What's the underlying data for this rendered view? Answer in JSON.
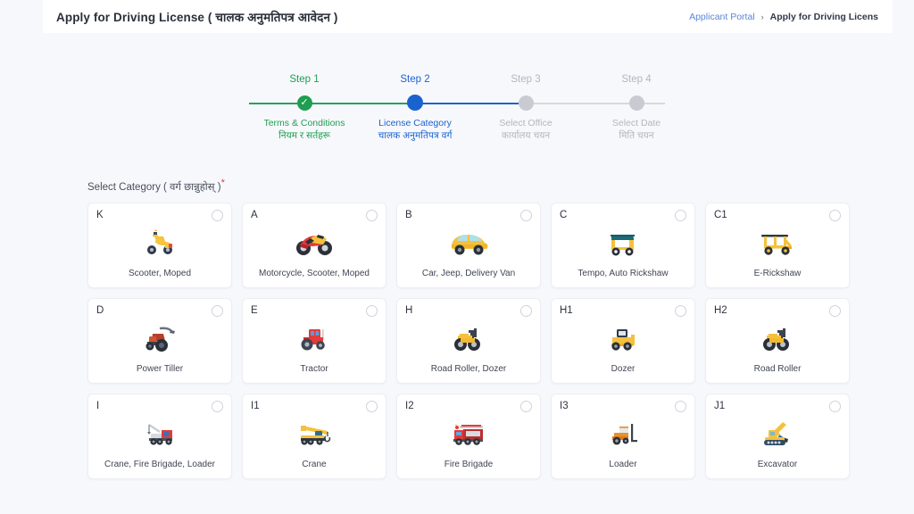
{
  "header": {
    "title": "Apply for Driving License ( चालक अनुमतिपत्र आवेदन )",
    "breadcrumb": {
      "link": "Applicant Portal",
      "separator": "›",
      "current": "Apply for Driving Licens"
    }
  },
  "stepper": {
    "steps": [
      {
        "number": "Step 1",
        "label_en": "Terms & Conditions",
        "label_np": "नियम र सर्तहरू",
        "state": "done",
        "check_glyph": "✓",
        "color": "#1f9e51"
      },
      {
        "number": "Step 2",
        "label_en": "License Category",
        "label_np": "चालक अनुमतिपत्र वर्ग",
        "state": "active",
        "check_glyph": "",
        "color": "#1a63cf"
      },
      {
        "number": "Step 3",
        "label_en": "Select Office",
        "label_np": "कार्यालय चयन",
        "state": "todo",
        "check_glyph": "",
        "color": "#b3b6bf"
      },
      {
        "number": "Step 4",
        "label_en": "Select Date",
        "label_np": "मिति चयन",
        "state": "todo",
        "check_glyph": "",
        "color": "#b3b6bf"
      }
    ]
  },
  "form": {
    "select_label": "Select Category ( वर्ग छान्नुहोस् )",
    "required_mark": "*"
  },
  "categories": [
    {
      "code": "K",
      "name": "Scooter, Moped",
      "icon": "scooter-icon",
      "selected": false
    },
    {
      "code": "A",
      "name": "Motorcycle, Scooter, Moped",
      "icon": "motorcycle-icon",
      "selected": false
    },
    {
      "code": "B",
      "name": "Car, Jeep, Delivery Van",
      "icon": "car-icon",
      "selected": false
    },
    {
      "code": "C",
      "name": "Tempo, Auto Rickshaw",
      "icon": "auto-rickshaw-icon",
      "selected": false
    },
    {
      "code": "C1",
      "name": "E-Rickshaw",
      "icon": "e-rickshaw-icon",
      "selected": false
    },
    {
      "code": "D",
      "name": "Power Tiller",
      "icon": "power-tiller-icon",
      "selected": false
    },
    {
      "code": "E",
      "name": "Tractor",
      "icon": "tractor-icon",
      "selected": false
    },
    {
      "code": "H",
      "name": "Road Roller, Dozer",
      "icon": "road-roller-icon",
      "selected": false
    },
    {
      "code": "H1",
      "name": "Dozer",
      "icon": "dozer-icon",
      "selected": false
    },
    {
      "code": "H2",
      "name": "Road Roller",
      "icon": "road-roller-icon",
      "selected": false
    },
    {
      "code": "I",
      "name": "Crane, Fire Brigade, Loader",
      "icon": "crane-truck-icon",
      "selected": false
    },
    {
      "code": "I1",
      "name": "Crane",
      "icon": "mobile-crane-icon",
      "selected": false
    },
    {
      "code": "I2",
      "name": "Fire Brigade",
      "icon": "fire-engine-icon",
      "selected": false
    },
    {
      "code": "I3",
      "name": "Loader",
      "icon": "forklift-icon",
      "selected": false
    },
    {
      "code": "J1",
      "name": "Excavator",
      "icon": "excavator-icon",
      "selected": false
    }
  ],
  "colors": {
    "page_bg": "#f7f8fc",
    "card_bg": "#ffffff",
    "accent_blue": "#1a63cf",
    "accent_green": "#1f9e51",
    "muted_grey": "#b3b6bf",
    "required_red": "#e03b3b",
    "link_blue": "#5b85d6"
  }
}
